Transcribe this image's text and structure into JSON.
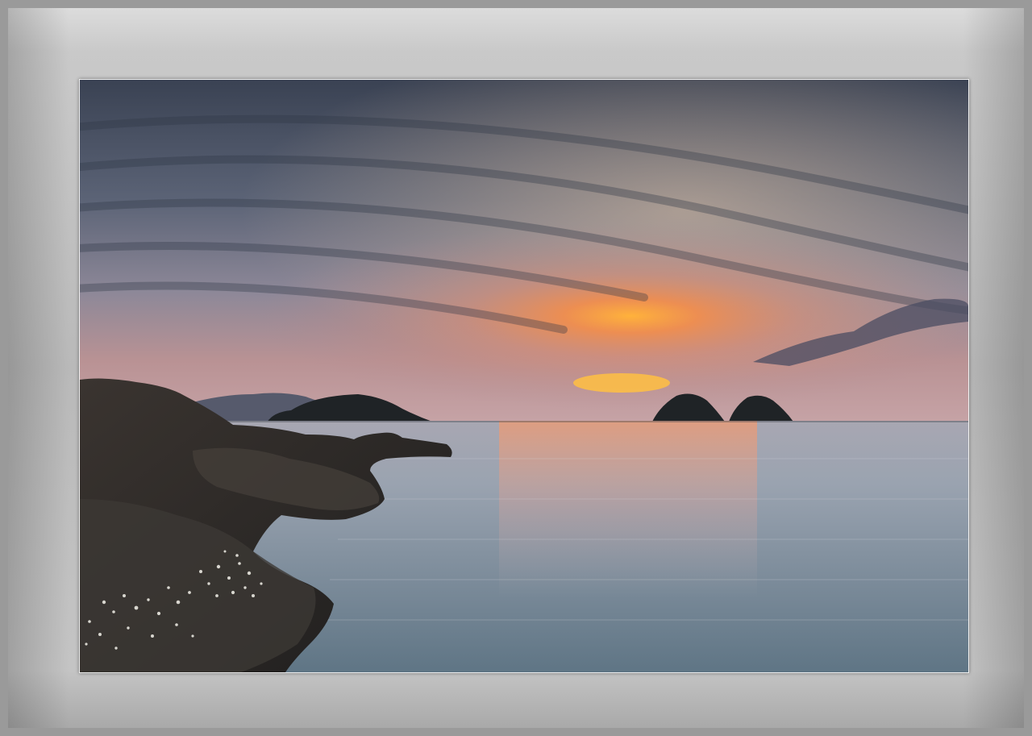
{
  "scene": {
    "frame": "grey-gradient-mat",
    "photo": "seascape-sunset",
    "elements": [
      "sky",
      "clouds",
      "sunset-glow",
      "sun",
      "distant-mountain",
      "left-island",
      "twin-islets",
      "sea",
      "sun-reflection",
      "foreground-rocks",
      "barnacles"
    ]
  },
  "colors": {
    "frame_light": "#dcdcdc",
    "frame_dark": "#9a9a9a",
    "sky_top": "#3c4556",
    "sky_mid": "#7a7f93",
    "sky_glow": "#d98060",
    "sun": "#ffb03a",
    "horizon": "#c8a7a6",
    "sea_top": "#9ea3ae",
    "sea_bottom": "#6c7d8a",
    "rock": "#2a2725",
    "barnacle": "#d8d6cf"
  }
}
